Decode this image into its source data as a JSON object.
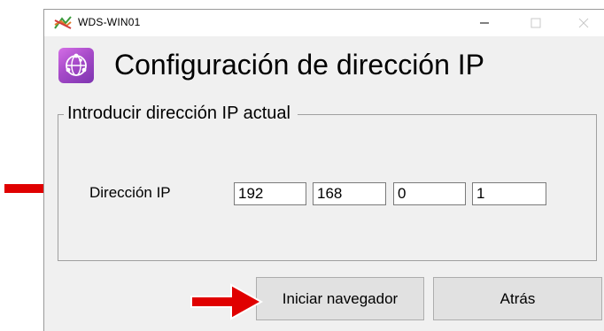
{
  "window": {
    "title": "WDS-WIN01",
    "app_icon": "wds-app-icon",
    "controls": {
      "minimize": "minimize-icon",
      "maximize": "maximize-icon",
      "close": "close-icon"
    }
  },
  "header": {
    "icon": "network-globe-icon",
    "title": "Configuración de dirección IP"
  },
  "group": {
    "legend": "Introducir dirección IP actual",
    "ip_label": "Dirección IP",
    "ip_octets": [
      "192",
      "168",
      "0",
      "1"
    ]
  },
  "buttons": {
    "browser": "Iniciar navegador",
    "back": "Atrás"
  },
  "annotations": {
    "arrow_color": "#e00000"
  },
  "colors": {
    "window_bg": "#f0f0f0",
    "titlebar_bg": "#ffffff",
    "button_bg": "#e1e1e1",
    "icon_purple": "#a74bc9"
  }
}
